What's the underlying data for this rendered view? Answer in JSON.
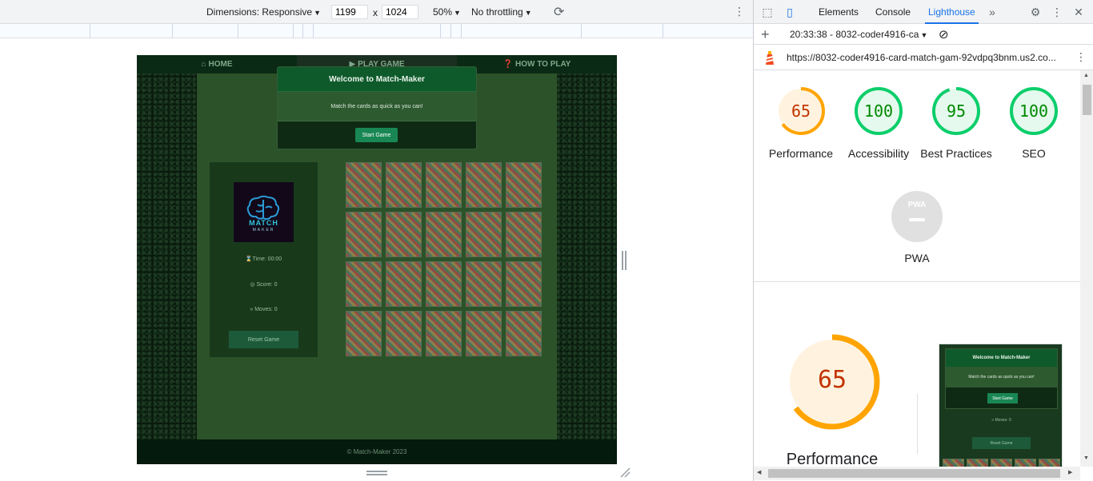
{
  "device_toolbar": {
    "dimensions_label": "Dimensions: Responsive",
    "width": "1199",
    "times": "x",
    "height": "1024",
    "zoom": "50%",
    "throttling": "No throttling"
  },
  "game": {
    "nav": [
      {
        "label": "HOME",
        "icon": "home-icon"
      },
      {
        "label": "PLAY GAME",
        "icon": "play-icon"
      },
      {
        "label": "HOW TO PLAY",
        "icon": "question-icon"
      }
    ],
    "modal": {
      "title": "Welcome to Match-Maker",
      "body": "Match the cards as quick as you can!",
      "start_label": "Start Game"
    },
    "logo": {
      "line1": "MATCH",
      "line2": "MAKER"
    },
    "stats": {
      "time": "Time: 00:00",
      "score": "Score: 0",
      "moves": "Moves: 0"
    },
    "reset_label": "Reset Game",
    "card_count": 20,
    "footer": "© Match-Maker 2023"
  },
  "devtools": {
    "tabs": [
      "Elements",
      "Console",
      "Lighthouse"
    ],
    "active_tab": "Lighthouse",
    "session": "20:33:38 - 8032-coder4916-ca",
    "url": "https://8032-coder4916-card-match-gam-92vdpq3bnm.us2.co...",
    "scores": [
      {
        "value": "65",
        "label": "Performance",
        "color": "#ffa400"
      },
      {
        "value": "100",
        "label": "Accessibility",
        "color": "#0cce6b"
      },
      {
        "value": "95",
        "label": "Best Practices",
        "color": "#0cce6b"
      },
      {
        "value": "100",
        "label": "SEO",
        "color": "#0cce6b"
      }
    ],
    "pwa_label": "PWA",
    "pwa_badge_text": "PWA",
    "perf_big": {
      "value": "65",
      "label": "Performance"
    },
    "thumbnail": {
      "title": "Welcome to Match-Maker",
      "body": "Match the cards as quick as you can!",
      "start_label": "Start Game",
      "moves": "Moves: 0",
      "reset_label": "Reset Game"
    }
  },
  "colors": {
    "accent": "#1a73e8",
    "average": "#ffa400",
    "pass": "#0cce6b"
  }
}
